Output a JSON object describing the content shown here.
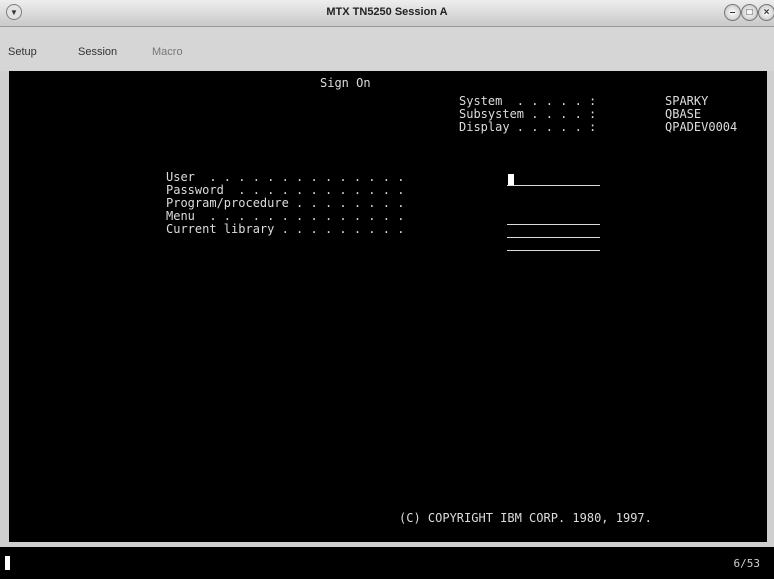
{
  "window": {
    "title": "MTX TN5250 Session A"
  },
  "menu": {
    "items": [
      "Setup",
      "Session",
      "Macro"
    ]
  },
  "terminal": {
    "screen_title": "Sign On",
    "system_info": [
      {
        "label": "System  . . . . . :",
        "value": "SPARKY"
      },
      {
        "label": "Subsystem . . . . :",
        "value": "QBASE"
      },
      {
        "label": "Display . . . . . :",
        "value": "QPADEV0004"
      }
    ],
    "fields": [
      {
        "label": "User  . . . . . . . . . . . . . .",
        "value": ""
      },
      {
        "label": "Password  . . . . . . . . . . . .",
        "value": ""
      },
      {
        "label": "Program/procedure . . . . . . . .",
        "value": ""
      },
      {
        "label": "Menu  . . . . . . . . . . . . . .",
        "value": ""
      },
      {
        "label": "Current library . . . . . . . . .",
        "value": ""
      }
    ],
    "copyright": "(C) COPYRIGHT IBM CORP. 1980, 1997."
  },
  "status": {
    "cursor_position": "6/53"
  }
}
